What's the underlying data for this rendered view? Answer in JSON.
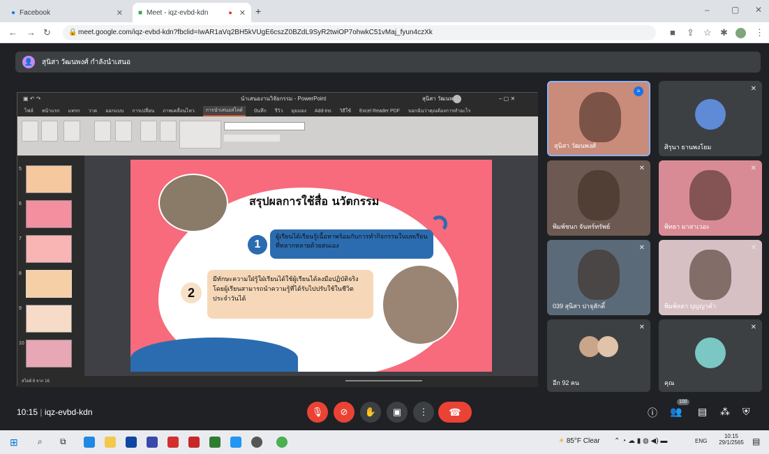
{
  "tabs": [
    {
      "label": "Facebook"
    },
    {
      "label": "Meet - iqz-evbd-kdn"
    }
  ],
  "address": {
    "url": "meet.google.com/iqz-evbd-kdn?fbclid=IwAR1aVq2BH5kVUgE6cszZ0BZdL9SyR2twiOP7ohwkC51vMaj_fyun4czXk"
  },
  "presenter": {
    "label": "สุนิสา วัฒนพงศ์ กำลังนำเสนอ"
  },
  "ppt": {
    "title": "นำเสนองานวิจัยกรรม - PowerPoint",
    "account": "สุนิสา วัฒนพงศ์",
    "menu": [
      "ไฟล์",
      "หน้าแรก",
      "แทรก",
      "วาด",
      "ออกแบบ",
      "การเปลี่ยน",
      "ภาพเคลื่อนไหว",
      "การนำเสนอสไลด์",
      "บันทึก",
      "รีวิว",
      "มุมมอง",
      "Add-ins",
      "วิธีใช้",
      "Excel Reader PDF",
      "บอกฉันว่าคุณต้องการทำอะไร"
    ],
    "active_menu": "การนำเสนอสไลด์",
    "thumb_numbers": [
      "5",
      "6",
      "7",
      "8",
      "9",
      "10"
    ],
    "status": "สไลด์ 8 จาก 16"
  },
  "slide": {
    "title": "สรุปผลการใช้สื่อ นวัตกรรม",
    "item1_number": "1",
    "item1_text": "ผู้เรียนได้เรียนรู้เนื้อหาพร้อมกับการทำกิจกรรมในบทเรียนที่หลากหลายด้วยตนเอง",
    "item2_number": "2",
    "item2_text": "มีทักษะความใฝ่รู้ใฝ่เรียนได้ใช้ผู้เรียนได้ลงมือปฏิบัติจริง โดยผู้เรียนสามารถนำความรู้ที่ได้รับไปปรับใช้ในชีวิตประจำวันได้"
  },
  "participants": [
    {
      "name": "สุนิสา วัฒนพงศ์",
      "color": "#c98b7a"
    },
    {
      "name": "ศิรุนา ธานพงโยม",
      "color": "#3c4043"
    },
    {
      "name": "พิมพ์ชนก จันทร์ทรัพย์",
      "color": "#6c5a52"
    },
    {
      "name": "พิทยา มาสาเวอะ",
      "color": "#d98b95"
    },
    {
      "name": "039 สุนิสา ปาจุสักดิ์",
      "color": "#5b6a78"
    },
    {
      "name": "พิมพ์ลดา บุญญาคำ",
      "color": "#d7c0c4"
    },
    {
      "name": "อีก 92 คน",
      "color": "#3c4043"
    },
    {
      "name": "คุณ",
      "color": "#3c4043"
    }
  ],
  "bottom": {
    "time": "10:15",
    "meeting_code": "iqz-evbd-kdn",
    "people_count": "100"
  },
  "taskbar": {
    "weather": "85°F Clear",
    "lang": "ENG",
    "time": "10:15",
    "date": "29/1/2565"
  }
}
